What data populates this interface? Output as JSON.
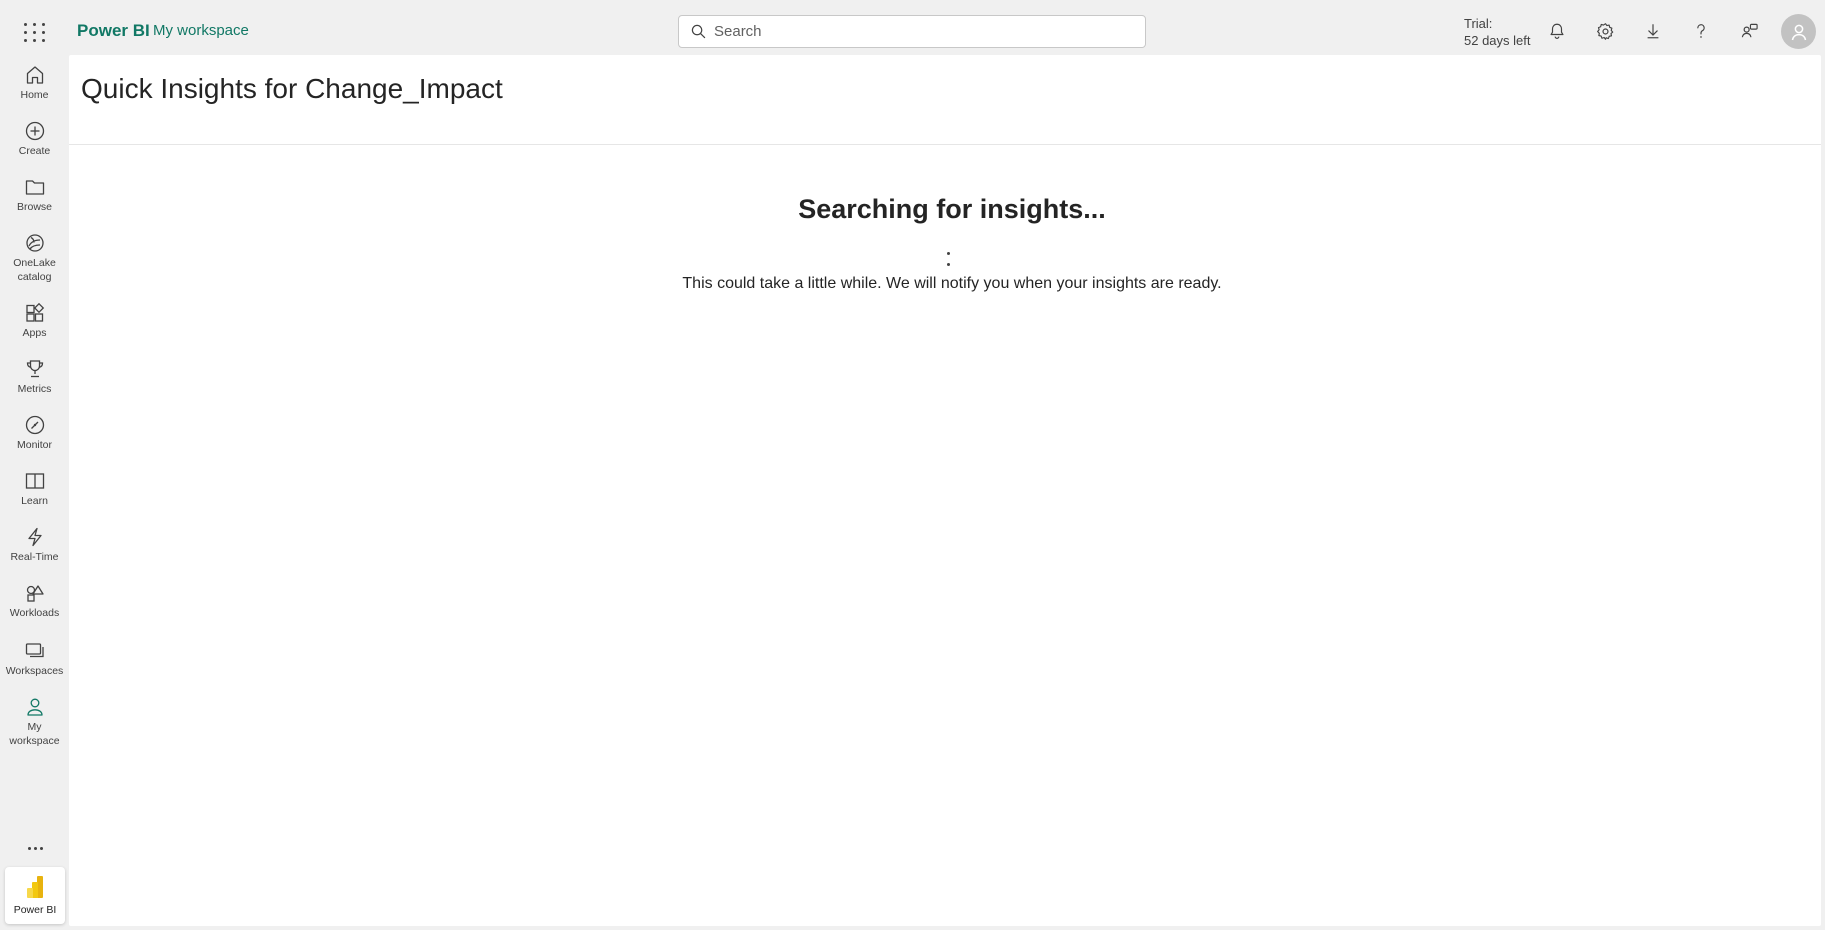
{
  "header": {
    "brand": "Power BI",
    "breadcrumb": "My workspace",
    "search_placeholder": "Search",
    "trial_line1": "Trial:",
    "trial_line2": "52 days left",
    "icons": [
      "waffle-icon",
      "bell-icon",
      "gear-icon",
      "download-icon",
      "help-icon",
      "feedback-icon",
      "avatar-icon"
    ]
  },
  "nav": {
    "items": [
      {
        "label": "Home",
        "icon": "home-icon"
      },
      {
        "label": "Create",
        "icon": "plus-circle-icon"
      },
      {
        "label": "Browse",
        "icon": "folder-icon"
      },
      {
        "label": "OneLake catalog",
        "line1": "OneLake",
        "line2": "catalog",
        "icon": "onelake-icon"
      },
      {
        "label": "Apps",
        "icon": "apps-icon"
      },
      {
        "label": "Metrics",
        "icon": "trophy-icon"
      },
      {
        "label": "Monitor",
        "icon": "monitor-icon"
      },
      {
        "label": "Learn",
        "icon": "book-icon"
      },
      {
        "label": "Real-Time",
        "icon": "lightning-icon"
      },
      {
        "label": "Workloads",
        "icon": "shapes-icon"
      },
      {
        "label": "Workspaces",
        "icon": "workspaces-icon"
      },
      {
        "label": "My workspace",
        "line1": "My",
        "line2": "workspace",
        "icon": "person-icon"
      }
    ],
    "more_icon": "more-icon",
    "switcher_label": "Power BI"
  },
  "main": {
    "title": "Quick Insights for Change_Impact",
    "heading": "Searching for insights...",
    "message": "This could take a little while. We will notify you when your insights are ready."
  },
  "colors": {
    "accent": "#117865",
    "chrome_background": "#f0f0f0",
    "content_background": "#ffffff",
    "text": "#242424"
  }
}
